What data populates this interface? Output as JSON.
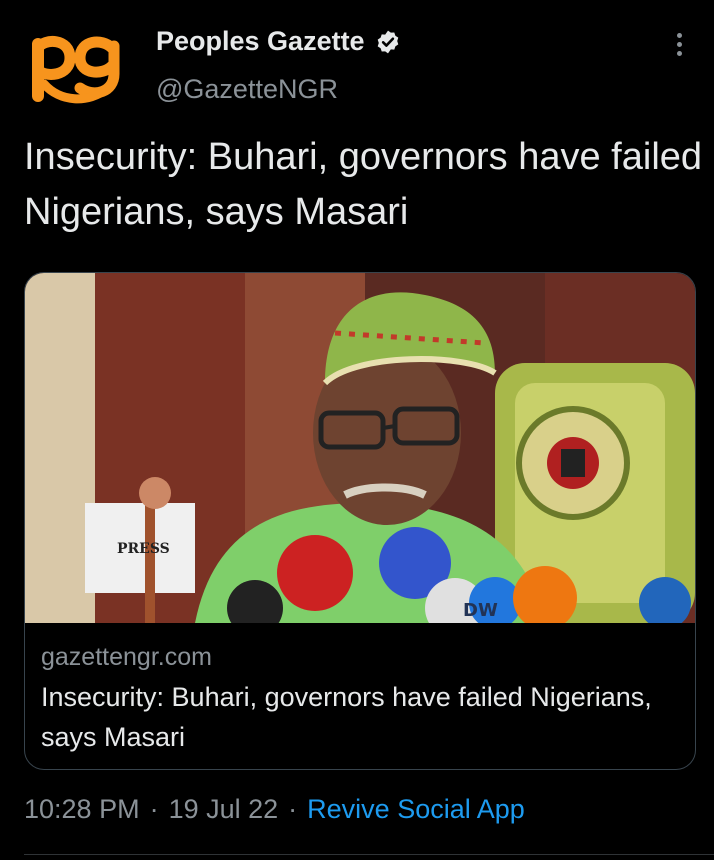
{
  "header": {
    "display_name": "Peoples Gazette",
    "handle": "@GazetteNGR",
    "avatar_logo_text": "pg"
  },
  "tweet": {
    "text": "Insecurity: Buhari, governors have failed Nigerians, says Masari"
  },
  "card": {
    "domain": "gazettengr.com",
    "title": "Insecurity: Buhari, governors have failed Nigerians, says Masari",
    "mic_labels": [
      "PRESS",
      "DW"
    ]
  },
  "meta": {
    "time": "10:28 PM",
    "separator": "·",
    "date": "19 Jul 22",
    "app": "Revive Social App"
  },
  "colors": {
    "background": "#000000",
    "text": "#e7e9ea",
    "muted": "#8b9298",
    "link": "#1d9bf0",
    "logo": "#f7941d",
    "border": "#38444d"
  },
  "icons": [
    "verified-badge-icon",
    "more-options-icon"
  ]
}
